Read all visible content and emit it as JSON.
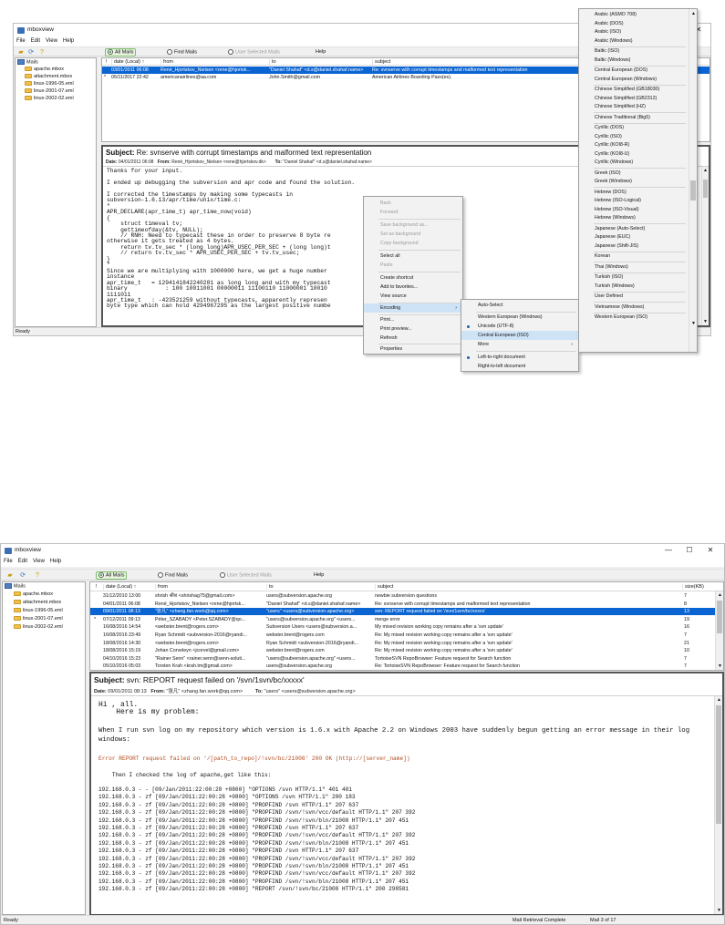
{
  "top": {
    "title": "mboxview",
    "menu": [
      "File",
      "Edit",
      "View",
      "Help"
    ],
    "toolbar": {
      "all_mails": "All Mails",
      "find_mails": "Find Mails",
      "user_selected": "User Selected Mails",
      "help": "Help"
    },
    "tree": {
      "root": "Mails",
      "items": [
        "apache.mbox",
        "attachment.mbox",
        "linux-1996-05.eml",
        "linux-2001-07.eml",
        "linux-2002-02.eml"
      ]
    },
    "columns": [
      "!",
      "date (Local) ↑",
      "from",
      "to",
      "subject"
    ],
    "rows": [
      {
        "flag": "",
        "date": "03/01/2011 06:08",
        "from": "René_Hjortskov_Nielsen <rene@hjortsk...",
        "to": "\"Daniel Shahaf\" <d.s@daniel.shahaf.name>",
        "subject": "Re: svnserve with corrupt timestamps and malformed text representation"
      },
      {
        "flag": "*",
        "date": "05/11/2017 22:42",
        "from": "americanairlines@aa.com",
        "to": "John.Smith@gmail.com",
        "subject": "American Airlines Boarding Pass(es)."
      }
    ],
    "preview": {
      "subject_label": "Subject:",
      "subject": "Re: svnserve with corrupt timestamps and malformed text representation",
      "date_label": "Date:",
      "date": "04/01/2011 06:08",
      "from_label": "From:",
      "from": "René_Hjortskov_Nielsen <rene@hjortskov.dk>",
      "to_label": "To:",
      "to": "\"Daniel Shahaf\" <d.s@daniel.shahaf.name>",
      "body": "Thanks for your input.\n\nI ended up debugging the subversion and apr code and found the solution.\n\nI corrected the timestamps by making some typecasts in\nsubversion-1.6.13/apr/time/unix/time.c:\n\"\nAPR_DECLARE(apr_time_t) apr_time_now(void)\n{\n    struct timeval tv;\n    gettimeofday(&tv, NULL);\n    // RNH: Need to typecast these in order to preserve 8 byte re\notherwise it gets treated as 4 bytes.\n    return tv.tv_sec * (long long)APR_USEC_PER_SEC + (long long)t\n    // return tv.tv_sec * APR_USEC_PER_SEC + tv.tv_usec;\n}\n\"\nSince we are multiplying with 1000000 here, we get a huge number\ninstance\napr_time_t   = 1294141842240281 as long long and with my typecast\nbinary           : 100 10011001 00000011 11100110 11000001 10010\n1111011\napr_time_t   : -423521259 without typecasts, apparently represen\nbyte type which can hold 4294967295 as the largest positive numbe"
    },
    "status": "Ready",
    "context_menu": [
      "Back",
      "Forward",
      "Save background as...",
      "Set as background",
      "Copy background",
      "Select all",
      "Paste",
      "Create shortcut",
      "Add to favorites...",
      "View source",
      "Encoding",
      "Print...",
      "Print preview...",
      "Refresh",
      "Properties"
    ],
    "encoding_menu": [
      "Auto-Select",
      "Western European (Windows)",
      "Unicode (UTF-8)",
      "Central European (ISO)",
      "More",
      "Left-to-right document",
      "Right-to-left document"
    ],
    "more_menu": [
      "Arabic (ASMO 708)",
      "Arabic (DOS)",
      "Arabic (ISO)",
      "Arabic (Windows)",
      "Baltic (ISO)",
      "Baltic (Windows)",
      "Central European (DOS)",
      "Central European (Windows)",
      "Chinese Simplified (GB18030)",
      "Chinese Simplified (GB2312)",
      "Chinese Simplified (HZ)",
      "Chinese Traditional (Big5)",
      "Cyrillic (DOS)",
      "Cyrillic (ISO)",
      "Cyrillic (KOI8-R)",
      "Cyrillic (KOI8-U)",
      "Cyrillic (Windows)",
      "Greek (ISO)",
      "Greek (Windows)",
      "Hebrew (DOS)",
      "Hebrew (ISO-Logical)",
      "Hebrew (ISO-Visual)",
      "Hebrew (Windows)",
      "Japanese (Auto-Select)",
      "Japanese (EUC)",
      "Japanese (Shift-JIS)",
      "Korean",
      "Thai (Windows)",
      "Turkish (ISO)",
      "Turkish (Windows)",
      "User Defined",
      "Vietnamese (Windows)",
      "Western European (ISO)"
    ]
  },
  "bottom": {
    "title": "mboxview",
    "window_controls": [
      "—",
      "☐",
      "✕"
    ],
    "menu": [
      "File",
      "Edit",
      "View",
      "Help"
    ],
    "toolbar": {
      "all_mails": "All Mails",
      "find_mails": "Find Mails",
      "user_selected": "User Selected Mails",
      "help": "Help"
    },
    "tree": {
      "root": "Mails",
      "items": [
        "apache.mbox",
        "attachment.mbox",
        "linux-1996-05.eml",
        "linux-2001-07.eml",
        "linux-2002-02.eml"
      ]
    },
    "columns": [
      "!",
      "date (Local) ↑",
      "from",
      "to",
      "subject",
      "size(KB)"
    ],
    "rows": [
      {
        "flag": "",
        "date": "31/12/2010 13:00",
        "from": "shrish श्रीश <shrishag75@gmail.com>",
        "to": "users@subversion.apache.org",
        "subject": "newbie subversion questions",
        "size": "7"
      },
      {
        "flag": "",
        "date": "04/01/2011 06:08",
        "from": "René_Hjortskov_Nielsen <rene@hjortsk...",
        "to": "\"Daniel Shahaf\" <d.s@daniel.shahaf.name>",
        "subject": "Re: svnserve with corrupt timestamps and malformed text representation",
        "size": "8"
      },
      {
        "flag": "",
        "date": "09/01/2011 08:13",
        "from": "\"张凡\" <zhang.fan.work@qq.com>",
        "to": "\"users\" <users@subversion.apache.org>",
        "subject": "svn: REPORT request failed on '/svn/1svn/bc/xxxxx'",
        "size": "13"
      },
      {
        "flag": "*",
        "date": "07/12/2011 09:13",
        "from": "Péter_SZABADY <Peter.SZABADY@qo...",
        "to": "\"users@subversion.apache.org\" <users...",
        "subject": "merge error",
        "size": "19"
      },
      {
        "flag": "",
        "date": "16/08/2016 14:54",
        "from": "<webster.brent@rogers.com>",
        "to": "Subversion Users <users@subversion.a...",
        "subject": "My mixed revision working copy remains after a 'svn update'",
        "size": "16"
      },
      {
        "flag": "",
        "date": "16/08/2016 23:49",
        "from": "Ryan Schmidt <subversion-2016@ryandi...",
        "to": "webster.brent@rogers.com",
        "subject": "Re: My mixed revision working copy remains after a 'svn update'",
        "size": "7"
      },
      {
        "flag": "",
        "date": "18/08/2016 14:30",
        "from": "<webster.brent@rogers.com>",
        "to": "Ryan Schmidt <subversion-2016@ryandi...",
        "subject": "Re: My mixed revision working copy remains after a 'svn update'",
        "size": "21"
      },
      {
        "flag": "",
        "date": "18/08/2016 15:19",
        "from": "Johan Corveleyn <jcorvel@gmail.com>",
        "to": "webster.brent@rogers.com",
        "subject": "Re: My mixed revision working copy remains after a 'svn update'",
        "size": "10"
      },
      {
        "flag": "",
        "date": "04/10/2016 15:23",
        "from": "\"Rainer Senn\" <rainer.senn@senn-soluti...",
        "to": "\"users@subversion.apache.org\" <users...",
        "subject": "TortoiseSVN RepoBrowser: Feature request for Search function",
        "size": "7"
      },
      {
        "flag": "",
        "date": "05/10/2016 05:03",
        "from": "Torsten Krah <krah.tm@gmail.com>",
        "to": "users@subversion.apache.org",
        "subject": "Re: TortoiseSVN RepoBrowser: Feature request for Search function",
        "size": "7"
      }
    ],
    "preview": {
      "subject_label": "Subject:",
      "subject": "svn: REPORT request failed on '/svn/1svn/bc/xxxxx'",
      "date_label": "Date:",
      "date": "09/01/2011 08:13",
      "from_label": "From:",
      "from": "\"张凡\" <zhang.fan.work@qq.com>",
      "to_label": "To:",
      "to": "\"users\" <users@subversion.apache.org>",
      "greeting": "Hi , all.\n    Here is my problem:",
      "para": "When I run svn log on my repository which version is 1.6.x with Apache 2.2 on Windows 2003 have suddenly begun getting an error message in their log\nwindows:",
      "error": "Error REPORT request failed on '/[path_to_repo]/!svn/bc/21008' 200 OK (http://[server_name])",
      "checked": "    Then I checked the log of apache,get like this:",
      "log": "192.168.0.3 - - [09/Jan/2011:22:00:28 +0800] \"OPTIONS /svn HTTP/1.1\" 401 401\n192.168.0.3 - zf [09/Jan/2011:22:00:28 +0800] \"OPTIONS /svn HTTP/1.1\" 200 183\n192.168.0.3 - zf [09/Jan/2011:22:00:28 +0800] \"PROPFIND /svn HTTP/1.1\" 207 637\n192.168.0.3 - zf [09/Jan/2011:22:00:28 +0800] \"PROPFIND /svn/!svn/vcc/default HTTP/1.1\" 207 392\n192.168.0.3 - zf [09/Jan/2011:22:00:28 +0800] \"PROPFIND /svn/!svn/bln/21008 HTTP/1.1\" 207 451\n192.168.0.3 - zf [09/Jan/2011:22:00:28 +0800] \"PROPFIND /svn HTTP/1.1\" 207 637\n192.168.0.3 - zf [09/Jan/2011:22:00:28 +0800] \"PROPFIND /svn/!svn/vcc/default HTTP/1.1\" 207 392\n192.168.0.3 - zf [09/Jan/2011:22:00:28 +0800] \"PROPFIND /svn/!svn/bln/21008 HTTP/1.1\" 207 451\n192.168.0.3 - zf [09/Jan/2011:22:00:28 +0800] \"PROPFIND /svn HTTP/1.1\" 207 637\n192.168.0.3 - zf [09/Jan/2011:22:00:28 +0800] \"PROPFIND /svn/!svn/vcc/default HTTP/1.1\" 207 392\n192.168.0.3 - zf [09/Jan/2011:22:00:28 +0800] \"PROPFIND /svn/!svn/bln/21008 HTTP/1.1\" 207 451\n192.168.0.3 - zf [09/Jan/2011:22:00:28 +0800] \"PROPFIND /svn/!svn/vcc/default HTTP/1.1\" 207 392\n192.168.0.3 - zf [09/Jan/2011:22:00:28 +0800] \"PROPFIND /svn/!svn/bln/21008 HTTP/1.1\" 207 451\n192.168.0.3 - zf [09/Jan/2011:22:00:28 +0800] \"REPORT /svn/!svn/bc/21008 HTTP/1.1\" 200 298581"
    },
    "status": {
      "ready": "Ready",
      "retrieval": "Mail Retrieval Complete",
      "count": "Mail 3 of 17"
    }
  },
  "colors": {
    "selection": "#0a64d2",
    "error_text": "#b04a1e",
    "highlight": "#cfe3f7"
  },
  "icons": [
    "mail-folder-icon",
    "folder-icon",
    "open-icon",
    "refresh-icon",
    "help-icon",
    "scroll-up-icon",
    "scroll-down-icon",
    "submenu-arrow-icon",
    "radio-bullet-icon"
  ]
}
